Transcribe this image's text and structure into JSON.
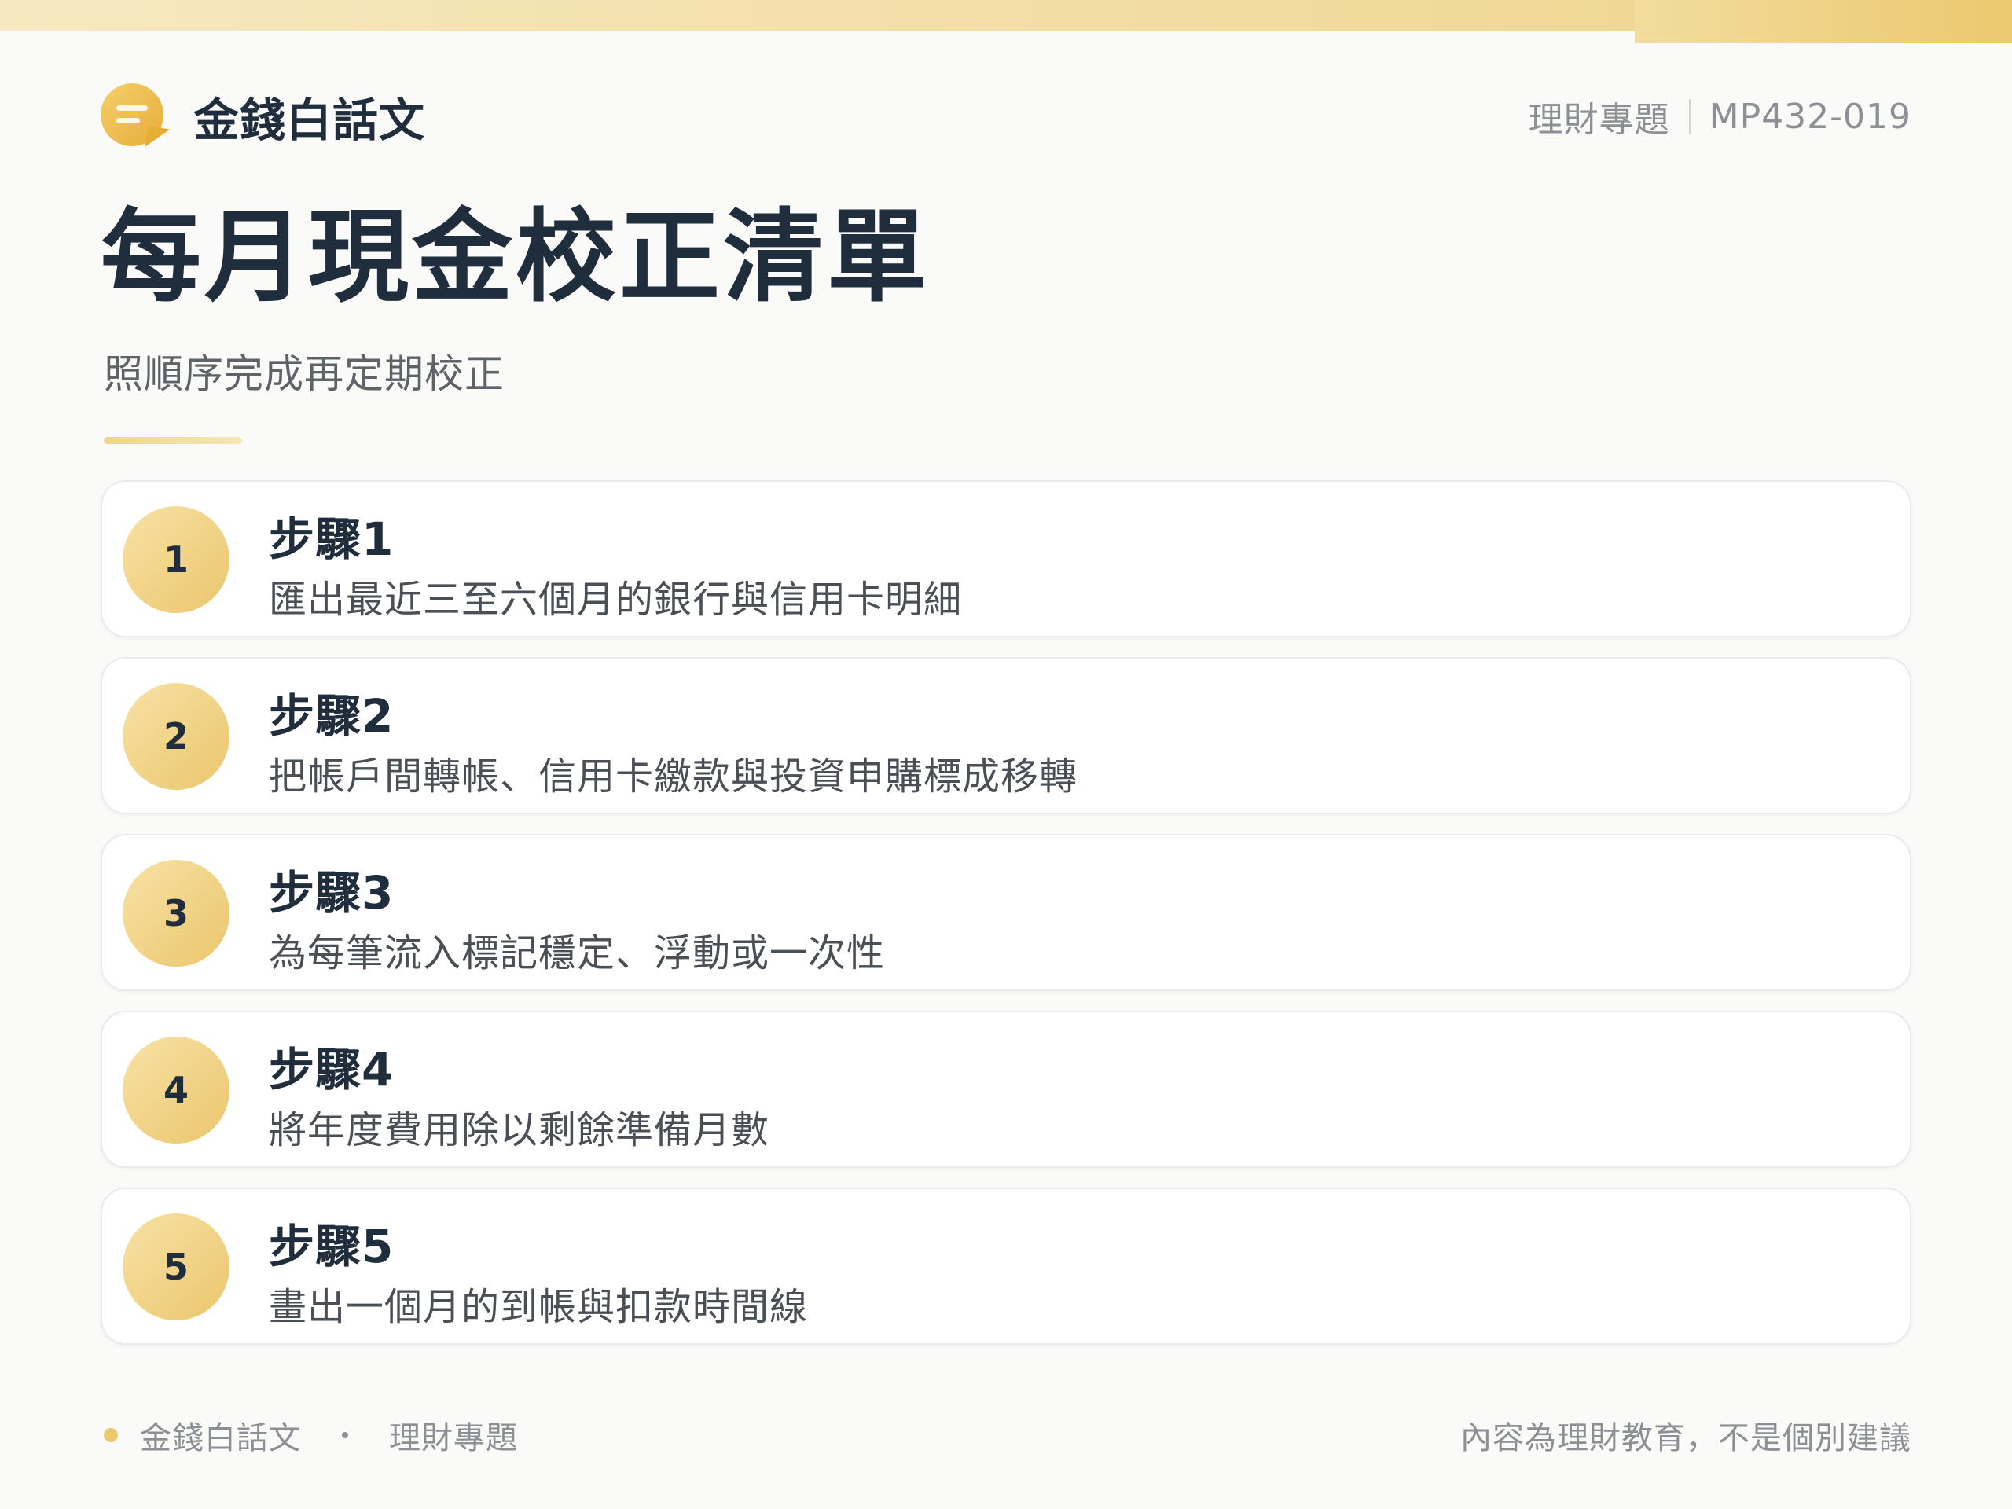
{
  "brand": {
    "name": "金錢白話文"
  },
  "header": {
    "category": "理財專題",
    "code": "MP432-019"
  },
  "title": "每月現金校正清單",
  "subtitle": "照順序完成再定期校正",
  "steps": [
    {
      "number": "1",
      "title": "步驟1",
      "description": "匯出最近三至六個月的銀行與信用卡明細"
    },
    {
      "number": "2",
      "title": "步驟2",
      "description": "把帳戶間轉帳、信用卡繳款與投資申購標成移轉"
    },
    {
      "number": "3",
      "title": "步驟3",
      "description": "為每筆流入標記穩定、浮動或一次性"
    },
    {
      "number": "4",
      "title": "步驟4",
      "description": "將年度費用除以剩餘準備月數"
    },
    {
      "number": "5",
      "title": "步驟5",
      "description": "畫出一個月的到帳與扣款時間線"
    }
  ],
  "footer": {
    "brand": "金錢白話文",
    "category": "理財專題",
    "disclaimer": "內容為理財教育，不是個別建議"
  },
  "colors": {
    "accent": "#ECC86F",
    "text": "#1F2D3D",
    "muted": "#8C8F93"
  },
  "icons": {
    "logo": "chat-bubble-icon"
  }
}
